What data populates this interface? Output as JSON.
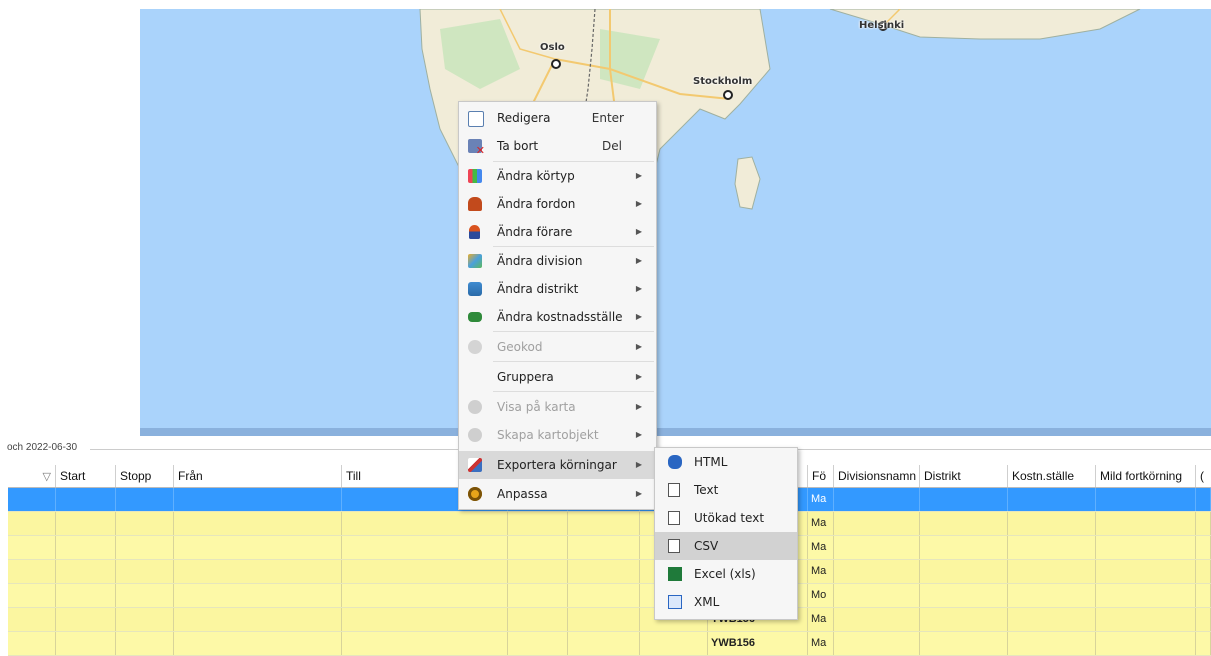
{
  "map": {
    "cities": [
      {
        "name": "Oslo"
      },
      {
        "name": "Stockholm"
      },
      {
        "name": "Helsinki"
      }
    ]
  },
  "grid": {
    "group_label": "och 2022-06-30",
    "sort_glyph": "▽",
    "columns": [
      "Start",
      "Stopp",
      "Från",
      "Till",
      "Fö",
      "Divisionsnamn",
      "Distrikt",
      "Kostn.ställe",
      "Mild fortkörning",
      "("
    ],
    "rows": [
      {
        "reg": "",
        "fo": "Ma"
      },
      {
        "reg": "",
        "fo": "Ma"
      },
      {
        "reg": "",
        "fo": "Ma"
      },
      {
        "reg": "",
        "fo": "Ma"
      },
      {
        "reg": "",
        "fo": "Mo"
      },
      {
        "reg": "YWB156",
        "fo": "Ma"
      },
      {
        "reg": "YWB156",
        "fo": "Ma"
      }
    ]
  },
  "context_menu": {
    "items": [
      {
        "label": "Redigera",
        "shortcut": "Enter",
        "icon": "edit-icon"
      },
      {
        "label": "Ta bort",
        "shortcut": "Del",
        "icon": "delete-icon"
      },
      {
        "label": "Ändra körtyp",
        "icon": "trip-type-icon"
      },
      {
        "label": "Ändra fordon",
        "icon": "vehicle-icon"
      },
      {
        "label": "Ändra förare",
        "icon": "driver-icon"
      },
      {
        "label": "Ändra division",
        "icon": "division-icon"
      },
      {
        "label": "Ändra distrikt",
        "icon": "district-icon"
      },
      {
        "label": "Ändra kostnadsställe",
        "icon": "cost-center-icon"
      },
      {
        "label": "Geokod",
        "icon": "geocode-icon"
      },
      {
        "label": "Gruppera"
      },
      {
        "label": "Visa på karta",
        "icon": "show-on-map-icon"
      },
      {
        "label": "Skapa kartobjekt",
        "icon": "map-object-icon"
      },
      {
        "label": "Exportera körningar",
        "icon": "export-icon"
      },
      {
        "label": "Anpassa",
        "icon": "customize-icon"
      }
    ],
    "submenu_arrow": "▶"
  },
  "export_submenu": {
    "items": [
      {
        "label": "HTML",
        "icon": "html-icon"
      },
      {
        "label": "Text",
        "icon": "text-file-icon"
      },
      {
        "label": "Utökad text",
        "icon": "extended-text-icon"
      },
      {
        "label": "CSV",
        "icon": "csv-icon"
      },
      {
        "label": "Excel (xls)",
        "icon": "excel-icon"
      },
      {
        "label": "XML",
        "icon": "xml-icon"
      }
    ]
  }
}
